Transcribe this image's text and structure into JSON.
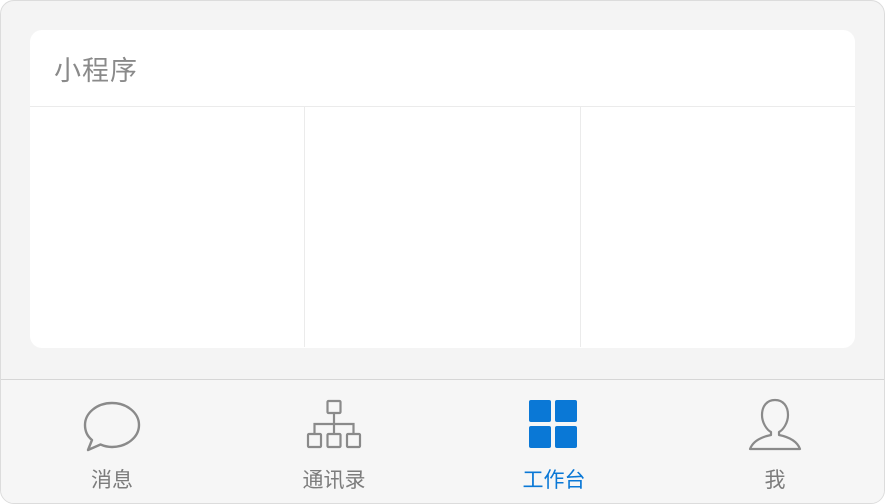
{
  "mini_programs": {
    "title": "小程序",
    "cells": [
      "",
      "",
      ""
    ]
  },
  "tabbar": {
    "active_color": "#0a78d6",
    "inactive_color": "#7c7c7c",
    "tabs": [
      {
        "label": "消息",
        "icon": "chat-bubble-icon",
        "active": false
      },
      {
        "label": "通讯录",
        "icon": "org-chart-icon",
        "active": false
      },
      {
        "label": "工作台",
        "icon": "grid-apps-icon",
        "active": true
      },
      {
        "label": "我",
        "icon": "person-icon",
        "active": false
      }
    ]
  }
}
